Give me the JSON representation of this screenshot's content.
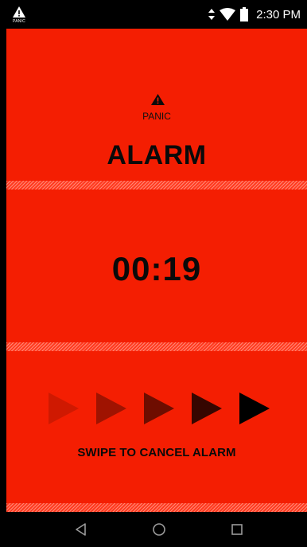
{
  "status_bar": {
    "notification_icon": "warning-icon",
    "notification_label": "PANIC",
    "icons": [
      "data-arrows-icon",
      "wifi-icon",
      "battery-icon"
    ],
    "time": "2:30 PM"
  },
  "alarm": {
    "type_icon": "warning-icon",
    "type_label": "PANIC",
    "title": "ALARM",
    "countdown": "00:19",
    "swipe_label": "SWIPE TO CANCEL ALARM",
    "swipe_arrows": 5
  },
  "nav_bar": {
    "buttons": [
      "back-icon",
      "home-icon",
      "recents-icon"
    ]
  },
  "colors": {
    "background": "#f41e02",
    "text": "#0a0a0a",
    "bars": "#000000"
  }
}
